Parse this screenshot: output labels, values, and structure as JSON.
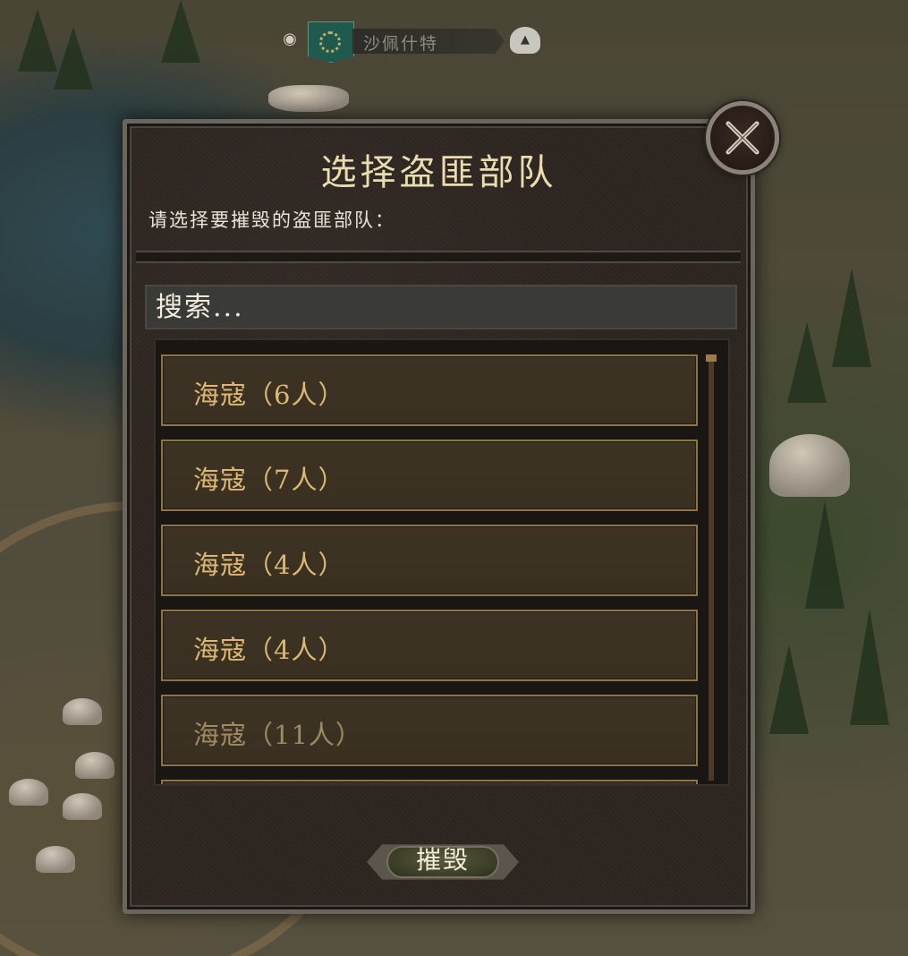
{
  "hud": {
    "settlement_name": "沙佩什特"
  },
  "dialog": {
    "title": "选择盗匪部队",
    "subtitle": "请选择要摧毁的盗匪部队：",
    "search_placeholder": "搜索...",
    "parties": [
      {
        "label": "海寇（6人）",
        "dim": false
      },
      {
        "label": "海寇（7人）",
        "dim": false
      },
      {
        "label": "海寇（4人）",
        "dim": false
      },
      {
        "label": "海寇（4人）",
        "dim": false
      },
      {
        "label": "海寇（11人）",
        "dim": true
      }
    ],
    "destroy_label": "摧毁"
  },
  "colors": {
    "title": "#eadcae",
    "party_text": "#ddb873",
    "party_border": "#8c7447",
    "hud_banner": "#1f5a4f"
  },
  "icons": [
    "eye-icon",
    "faction-banner-icon",
    "helmet-icon",
    "close-icon"
  ]
}
